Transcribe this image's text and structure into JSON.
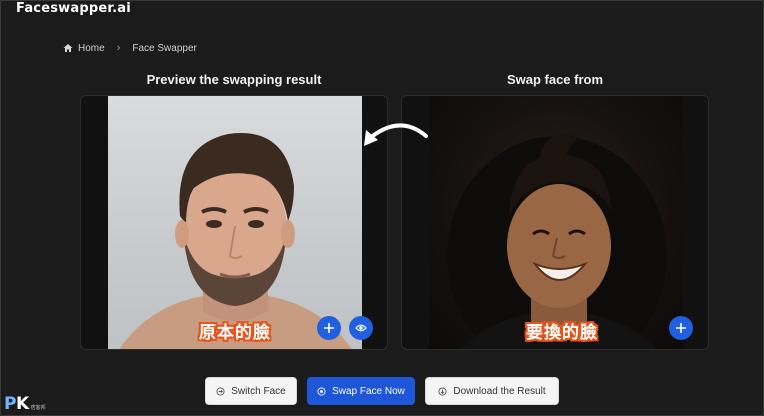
{
  "app": {
    "brand": "Faceswapper.ai"
  },
  "breadcrumb": {
    "home": "Home",
    "current": "Face Swapper"
  },
  "panels": {
    "preview": {
      "title": "Preview the swapping result",
      "caption": "原本的臉"
    },
    "source": {
      "title": "Swap face from",
      "caption": "要換的臉"
    }
  },
  "actions": {
    "switch": "Switch Face",
    "swap": "Swap Face Now",
    "download": "Download the Result"
  },
  "watermark": {
    "logo_p": "P",
    "logo_k": "K",
    "sub": "痞客邦"
  },
  "colors": {
    "accent": "#1f5fe0",
    "caption_outline": "#e8541c",
    "background": "#1b1b1b"
  },
  "icons": [
    "home-icon",
    "chevron-right-icon",
    "plus-icon",
    "eye-icon",
    "curved-arrow-icon",
    "switch-icon",
    "swap-icon",
    "download-icon"
  ]
}
